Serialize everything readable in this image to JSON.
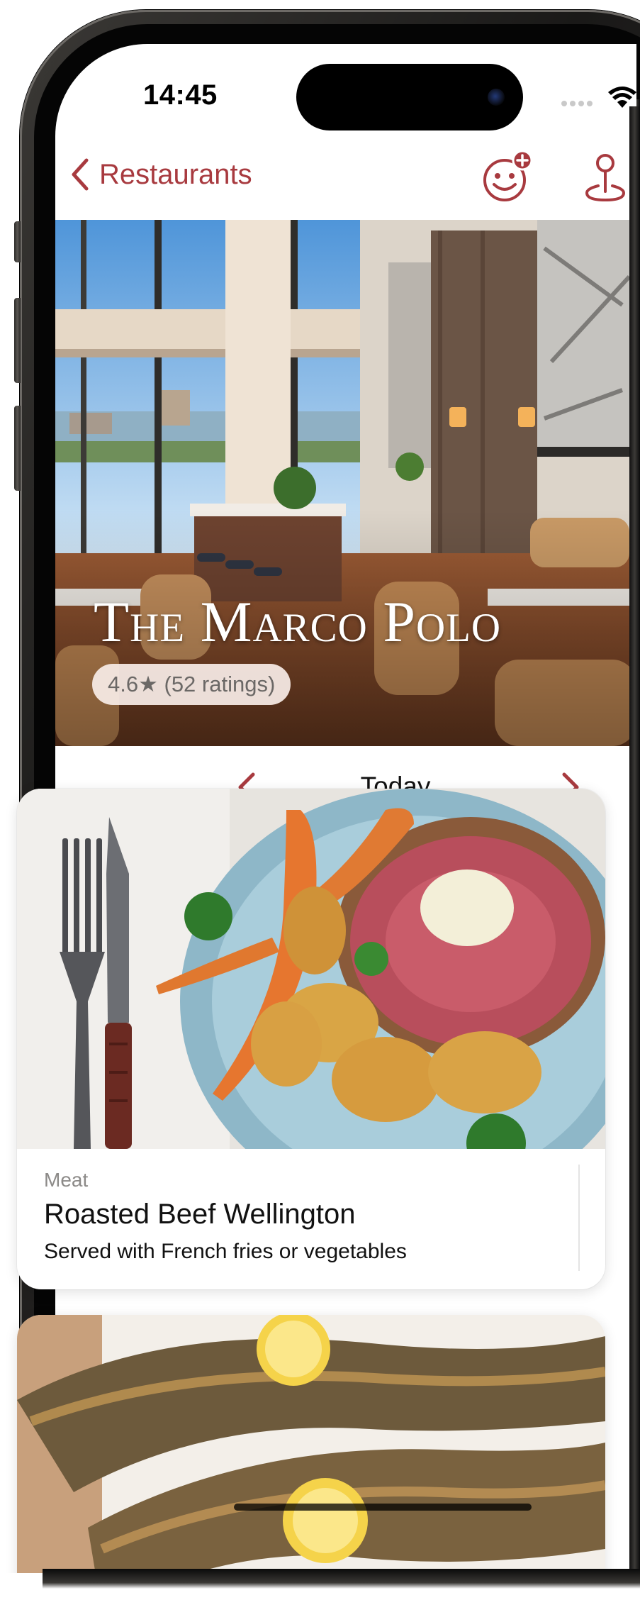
{
  "status_bar": {
    "time": "14:45"
  },
  "nav": {
    "back_label": "Restaurants",
    "icons": {
      "back": "chevron-left-icon",
      "add_diner": "smiley-plus-icon",
      "map": "map-pin-icon"
    }
  },
  "restaurant": {
    "name": "The Marco Polo",
    "rating_text": "4.6★ (52 ratings)"
  },
  "date_picker": {
    "label": "Today"
  },
  "meals": [
    {
      "category": "Meat",
      "name": "Roasted Beef Wellington",
      "description": "Served with French fries or vegetables"
    }
  ],
  "colors": {
    "accent": "#a83a3f",
    "text_primary": "#111111",
    "text_secondary": "#8c8a88"
  }
}
